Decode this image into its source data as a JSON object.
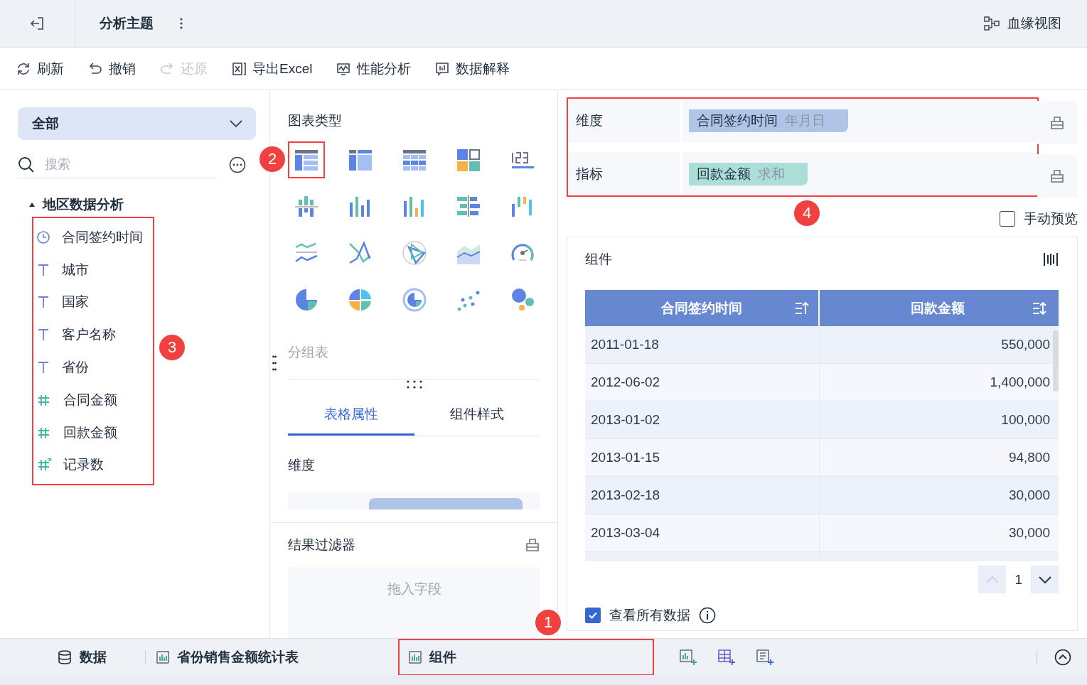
{
  "header": {
    "title": "分析主题",
    "lineage": "血缘视图"
  },
  "toolbar": [
    {
      "label": "刷新",
      "kind": "refresh",
      "disabled": false
    },
    {
      "label": "撤销",
      "kind": "undo",
      "disabled": false
    },
    {
      "label": "还原",
      "kind": "redo",
      "disabled": true
    },
    {
      "label": "导出Excel",
      "kind": "excel",
      "disabled": false
    },
    {
      "label": "性能分析",
      "kind": "perf",
      "disabled": false
    },
    {
      "label": "数据解释",
      "kind": "explain",
      "disabled": false
    }
  ],
  "data_panel": {
    "scope": "全部",
    "search": {
      "placeholder": "搜索"
    },
    "tree": {
      "label": "地区数据分析",
      "expanded": true,
      "children": [
        {
          "label": "合同签约时间",
          "kind": "date"
        },
        {
          "label": "城市",
          "kind": "text"
        },
        {
          "label": "国家",
          "kind": "text"
        },
        {
          "label": "客户名称",
          "kind": "text"
        },
        {
          "label": "省份",
          "kind": "text"
        },
        {
          "label": "合同金额",
          "kind": "number"
        },
        {
          "label": "回款金额",
          "kind": "number"
        },
        {
          "label": "记录数",
          "kind": "count"
        }
      ]
    }
  },
  "chart_panel": {
    "title": "图表类型",
    "chart_types": [
      {
        "selected": true
      },
      {
        "selected": false
      },
      {
        "selected": false
      },
      {
        "selected": false
      },
      {
        "selected": false
      },
      {
        "selected": false
      },
      {
        "selected": false
      },
      {
        "selected": false
      },
      {
        "selected": false
      },
      {
        "selected": false
      },
      {
        "selected": false
      },
      {
        "selected": false
      },
      {
        "selected": false
      },
      {
        "selected": false
      },
      {
        "selected": false
      },
      {
        "selected": false
      },
      {
        "selected": false
      },
      {
        "selected": false
      },
      {
        "selected": false
      },
      {
        "selected": false
      }
    ],
    "chart_name": "分组表",
    "tabs": [
      {
        "label": "表格属性",
        "selected": true
      },
      {
        "label": "组件样式",
        "selected": false
      }
    ],
    "section": "维度",
    "filter": {
      "title": "结果过滤器",
      "placeholder": "拖入字段"
    }
  },
  "fields": [
    {
      "label": "维度",
      "field": "合同签约时间",
      "aggregation": "年月日",
      "color": "#b0c4e8"
    },
    {
      "label": "指标",
      "field": "回款金额",
      "aggregation": "求和",
      "color": "#acded8"
    }
  ],
  "manual_preview": {
    "label": "手动预览",
    "checked": false
  },
  "component": {
    "title": "组件",
    "table": {
      "columns": [
        "合同签约时间",
        "回款金额"
      ],
      "rows": [
        [
          "2011-01-18",
          "550,000"
        ],
        [
          "2012-06-02",
          "1,400,000"
        ],
        [
          "2013-01-02",
          "100,000"
        ],
        [
          "2013-01-15",
          "94,800"
        ],
        [
          "2013-02-18",
          "30,000"
        ],
        [
          "2013-03-04",
          "30,000"
        ]
      ]
    },
    "page": "1",
    "view_all": {
      "label": "查看所有数据",
      "checked": true
    }
  },
  "bottom_tabs": [
    {
      "label": "数据",
      "kind": "data",
      "selected": false
    },
    {
      "label": "省份销售金额统计表",
      "kind": "chart",
      "selected": false
    },
    {
      "label": "组件",
      "kind": "chart",
      "selected": true
    }
  ],
  "callouts": [
    "1",
    "2",
    "3",
    "4"
  ]
}
